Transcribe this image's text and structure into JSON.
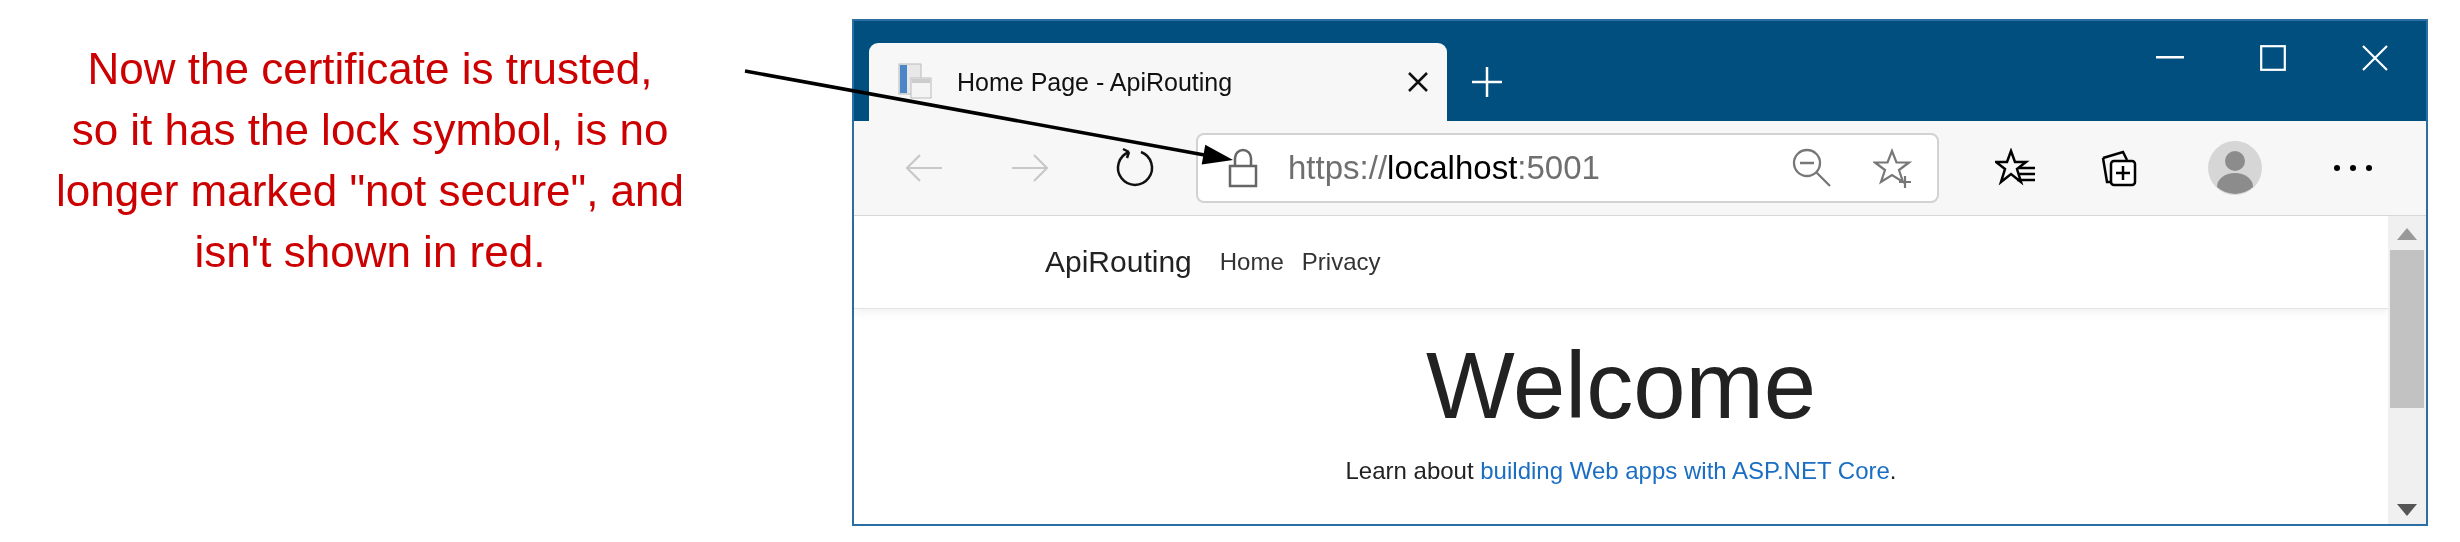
{
  "annotation": {
    "text": "Now the certificate is trusted,\nso it has the lock symbol, is no\nlonger marked \"not secure\", and\nisn't shown in red."
  },
  "browser": {
    "tabs": [
      {
        "title": "Home Page - ApiRouting",
        "selected": true
      }
    ],
    "toolbar": {
      "back": {
        "disabled": true
      },
      "forward": {
        "disabled": true
      }
    },
    "address_bar": {
      "secure": true,
      "scheme": "https://",
      "host": "localhost",
      "port": ":5001"
    },
    "page": {
      "brand": "ApiRouting",
      "nav_links": [
        "Home",
        "Privacy"
      ],
      "heading": "Welcome",
      "intro": "Learn about ",
      "link": "building Web apps with ASP.NET Core",
      "intro_end": "."
    }
  }
}
